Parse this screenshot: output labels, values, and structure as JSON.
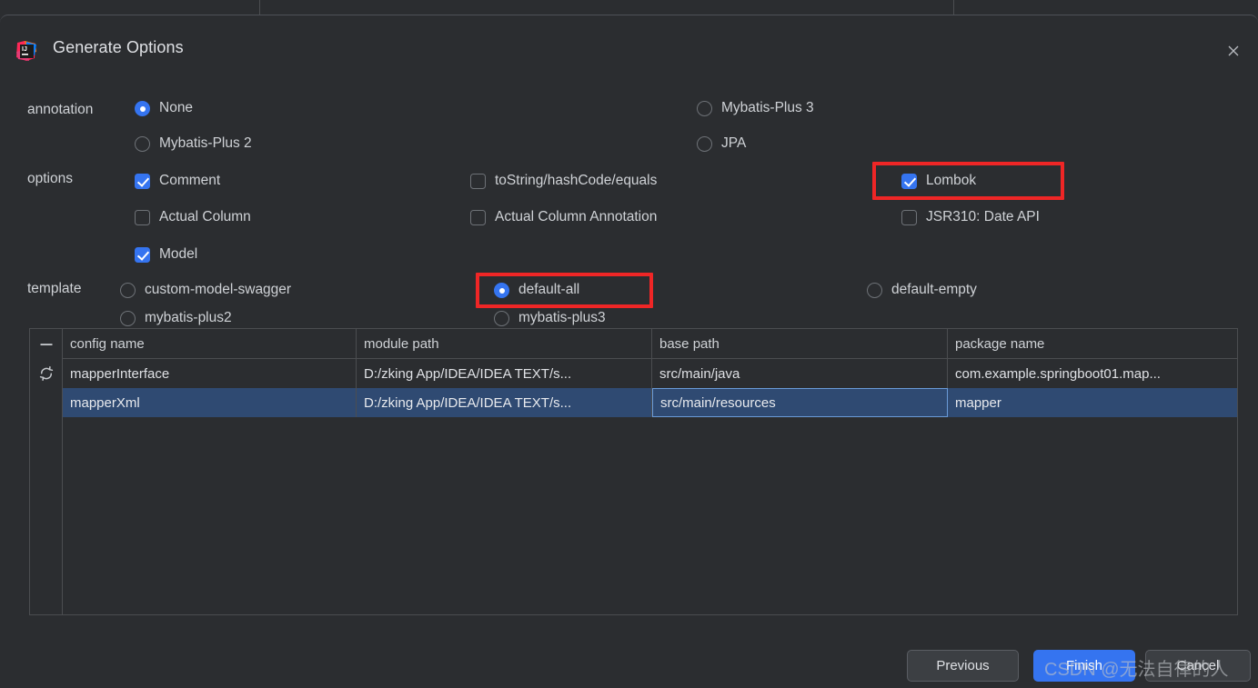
{
  "dialog": {
    "title": "Generate Options",
    "logo_icon": "intellij-idea-logo",
    "close_icon": "close-icon"
  },
  "annotation": {
    "label": "annotation",
    "options": [
      {
        "label": "None",
        "selected": true
      },
      {
        "label": "Mybatis-Plus 3",
        "selected": false
      },
      {
        "label": "Mybatis-Plus 2",
        "selected": false
      },
      {
        "label": "JPA",
        "selected": false
      }
    ]
  },
  "options": {
    "label": "options",
    "items": [
      {
        "label": "Comment",
        "checked": true,
        "highlighted": false
      },
      {
        "label": "toString/hashCode/equals",
        "checked": false,
        "highlighted": false
      },
      {
        "label": "Lombok",
        "checked": true,
        "highlighted": true
      },
      {
        "label": "Actual Column",
        "checked": false,
        "highlighted": false
      },
      {
        "label": "Actual Column Annotation",
        "checked": false,
        "highlighted": false
      },
      {
        "label": "JSR310: Date API",
        "checked": false,
        "highlighted": false
      },
      {
        "label": "Model",
        "checked": true,
        "highlighted": false
      }
    ]
  },
  "template": {
    "label": "template",
    "options": [
      {
        "label": "custom-model-swagger",
        "selected": false,
        "highlighted": false
      },
      {
        "label": "default-all",
        "selected": true,
        "highlighted": true
      },
      {
        "label": "default-empty",
        "selected": false,
        "highlighted": false
      },
      {
        "label": "mybatis-plus2",
        "selected": false,
        "highlighted": false
      },
      {
        "label": "mybatis-plus3",
        "selected": false,
        "highlighted": false
      }
    ]
  },
  "table": {
    "gutter": {
      "remove_icon": "minus-icon",
      "refresh_icon": "refresh-icon"
    },
    "headers": [
      "config name",
      "module path",
      "base path",
      "package name"
    ],
    "rows": [
      {
        "config_name": "mapperInterface",
        "module_path": "D:/zking App/IDEA/IDEA TEXT/s...",
        "base_path": "src/main/java",
        "package_name": "com.example.springboot01.map...",
        "selected": false,
        "focused_cell": null
      },
      {
        "config_name": "mapperXml",
        "module_path": "D:/zking App/IDEA/IDEA TEXT/s...",
        "base_path": "src/main/resources",
        "package_name": "mapper",
        "selected": true,
        "focused_cell": "base_path"
      }
    ]
  },
  "footer": {
    "previous_label": "Previous",
    "finish_label": "Finish",
    "cancel_label": "Cancel"
  },
  "watermark": {
    "text": "CSDN @无法自律的人"
  },
  "colors": {
    "accent": "#3574f0",
    "dialog_bg": "#2b2d30",
    "selection": "#2f4a72",
    "highlight_box": "#ef2626",
    "text": "#dfe1e5"
  }
}
